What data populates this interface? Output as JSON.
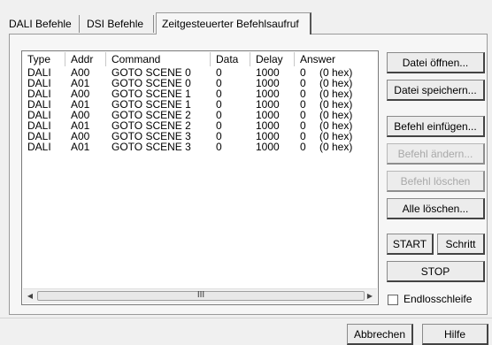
{
  "tabs": [
    {
      "label": "DALI Befehle"
    },
    {
      "label": "DSI Befehle"
    },
    {
      "label": "Zeitgesteuerter Befehlsaufruf"
    }
  ],
  "table": {
    "columns": [
      "Type",
      "Addr",
      "Command",
      "Data",
      "Delay",
      "Answer"
    ],
    "rows": [
      [
        "DALI",
        "A00",
        "GOTO SCENE 0",
        "0",
        "1000",
        "0",
        "(0 hex)"
      ],
      [
        "DALI",
        "A01",
        "GOTO SCENE 0",
        "0",
        "1000",
        "0",
        "(0 hex)"
      ],
      [
        "DALI",
        "A00",
        "GOTO SCENE 1",
        "0",
        "1000",
        "0",
        "(0 hex)"
      ],
      [
        "DALI",
        "A01",
        "GOTO SCENE 1",
        "0",
        "1000",
        "0",
        "(0 hex)"
      ],
      [
        "DALI",
        "A00",
        "GOTO SCENE 2",
        "0",
        "1000",
        "0",
        "(0 hex)"
      ],
      [
        "DALI",
        "A01",
        "GOTO SCENE 2",
        "0",
        "1000",
        "0",
        "(0 hex)"
      ],
      [
        "DALI",
        "A00",
        "GOTO SCENE 3",
        "0",
        "1000",
        "0",
        "(0 hex)"
      ],
      [
        "DALI",
        "A01",
        "GOTO SCENE 3",
        "0",
        "1000",
        "0",
        "(0 hex)"
      ]
    ]
  },
  "scrollbar": {
    "thumb_grip": "III"
  },
  "buttons": {
    "open": "Datei öffnen...",
    "save": "Datei speichern...",
    "insert": "Befehl einfügen...",
    "change": "Befehl ändern...",
    "delete": "Befehl löschen",
    "clear_all": "Alle löschen...",
    "start": "START",
    "step": "Schritt",
    "stop": "STOP"
  },
  "loop": {
    "label": "Endlosschleife",
    "checked": false
  },
  "footer": {
    "cancel": "Abbrechen",
    "help": "Hilfe"
  },
  "icons": {
    "left": "scroll-left-arrow-icon",
    "right": "scroll-right-arrow-icon"
  }
}
